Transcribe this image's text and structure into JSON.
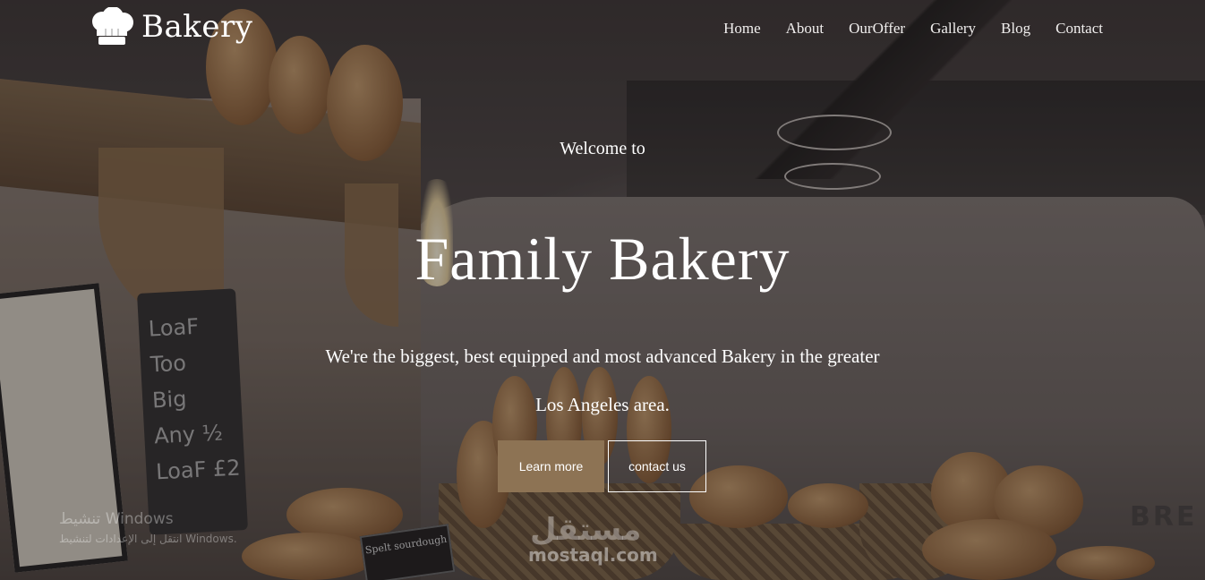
{
  "brand": {
    "name": "Bakery",
    "icon": "chef-hat-icon"
  },
  "nav": {
    "items": [
      {
        "label": "Home"
      },
      {
        "label": "About"
      },
      {
        "label": "OurOffer"
      },
      {
        "label": "Gallery"
      },
      {
        "label": "Blog"
      },
      {
        "label": "Contact"
      }
    ]
  },
  "hero": {
    "welcome": "Welcome to",
    "title": "Family Bakery",
    "description_line1": "We're the biggest, best equipped and most advanced Bakery in the greater",
    "description_line2": "Los Angeles area.",
    "learn_more_label": "Learn more",
    "contact_label": "contact us"
  },
  "background": {
    "chalkboard_text": [
      "LoaF Too",
      "Big",
      "Any ½",
      "LoaF £2"
    ],
    "sign_text": "Spelt sourdough",
    "oven_text": "BRE"
  },
  "watermarks": {
    "windows_title": "تنشيط Windows",
    "windows_subtitle": "انتقل إلى الإعدادات لتنشيط Windows.",
    "mostaql_ar": "مستقل",
    "mostaql": "mostaql.com"
  },
  "colors": {
    "accent": "#8d7354",
    "text": "#ffffff"
  }
}
